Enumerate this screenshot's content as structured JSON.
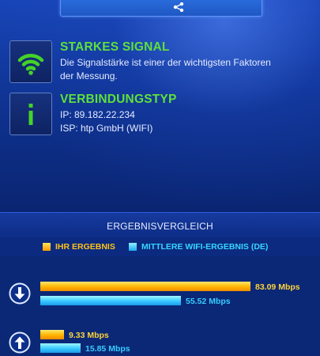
{
  "colors": {
    "accent_green": "#5ee03a",
    "your_result": "#ffb400",
    "average_result": "#38c8ff",
    "background": "#0a2a78"
  },
  "top_button": {
    "icon": "share-icon"
  },
  "info": [
    {
      "icon": "wifi-signal-icon",
      "title": "STARKES SIGNAL",
      "lines": [
        "Die Signalstärke ist einer der wichtigsten Faktoren",
        "der Messung."
      ]
    },
    {
      "icon": "info-icon",
      "title": "VERBINDUNGSTYP",
      "lines": [
        "IP: 89.182.22.234",
        "ISP: htp GmbH (WIFI)"
      ]
    }
  ],
  "comparison": {
    "title": "ERGEBNISVERGLEICH",
    "legend": {
      "yours": "IHR ERGEBNIS",
      "average": "MITTLERE WIFI-ERGEBNIS (DE)"
    },
    "scale_max_mbps": 100,
    "rows": [
      {
        "icon": "download-arrow-icon",
        "yours": {
          "value": 83.09,
          "label": "83.09 Mbps"
        },
        "average": {
          "value": 55.52,
          "label": "55.52 Mbps"
        }
      },
      {
        "icon": "upload-arrow-icon",
        "yours": {
          "value": 9.33,
          "label": "9.33 Mbps"
        },
        "average": {
          "value": 15.85,
          "label": "15.85 Mbps"
        }
      }
    ]
  }
}
